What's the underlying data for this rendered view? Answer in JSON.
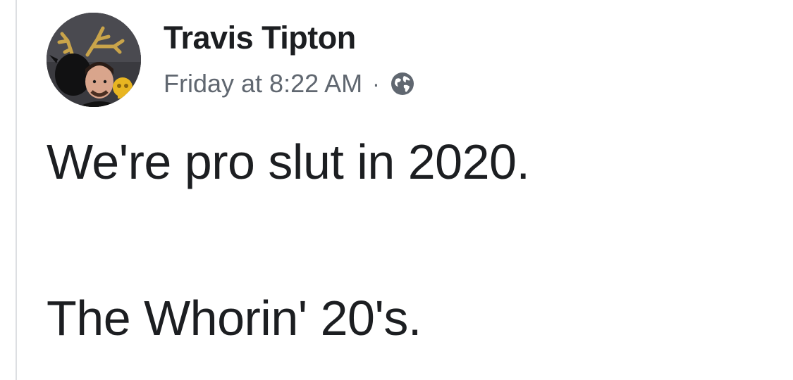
{
  "post": {
    "author_name": "Travis Tipton",
    "timestamp": "Friday at 8:22 AM",
    "separator": "·",
    "privacy_icon": "globe-icon",
    "text_lines": [
      "We're pro slut in 2020.",
      "The Whorin' 20's."
    ]
  },
  "colors": {
    "author": "#1c1e21",
    "meta": "#606770",
    "body_text": "#1c1e21",
    "border": "#dddfe2"
  }
}
